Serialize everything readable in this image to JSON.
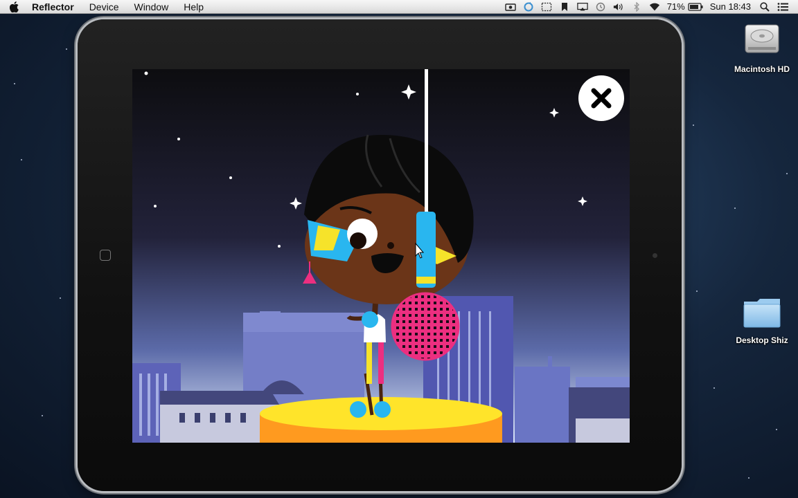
{
  "menubar": {
    "apple_icon": "apple-icon",
    "app_name": "Reflector",
    "items": [
      "Device",
      "Window",
      "Help"
    ],
    "status": {
      "battery_percent": "71%",
      "clock": "Sun 18:43",
      "icons": [
        "camera-icon",
        "sync-icon",
        "screen-select-icon",
        "bookmark-icon",
        "airplay-icon",
        "time-machine-icon",
        "volume-icon",
        "bluetooth-icon",
        "wifi-icon",
        "battery-icon",
        "spotlight-icon",
        "notification-list-icon"
      ]
    }
  },
  "desktop": {
    "icons": [
      {
        "label": "Macintosh HD",
        "icon": "hard-drive-icon"
      },
      {
        "label": "Desktop Shiz",
        "icon": "folder-icon"
      }
    ]
  },
  "ipad": {
    "close_button_icon": "close-icon",
    "home_button_icon": "home-button-icon",
    "scene": "character-singing-rooftop-night"
  },
  "colors": {
    "sky_top": "#0d0d10",
    "sky_mid": "#2a2a48",
    "sky_horizon": "#c9d7f2",
    "building_blue": "#5d63b8",
    "building_light": "#9aa6dc",
    "stage_yellow": "#ffe42a",
    "stage_orange": "#ff9a1f",
    "mic_blue": "#29b6ef",
    "mic_pink": "#ec2f80",
    "skin": "#6b3518",
    "hair": "#0b0b0b"
  }
}
